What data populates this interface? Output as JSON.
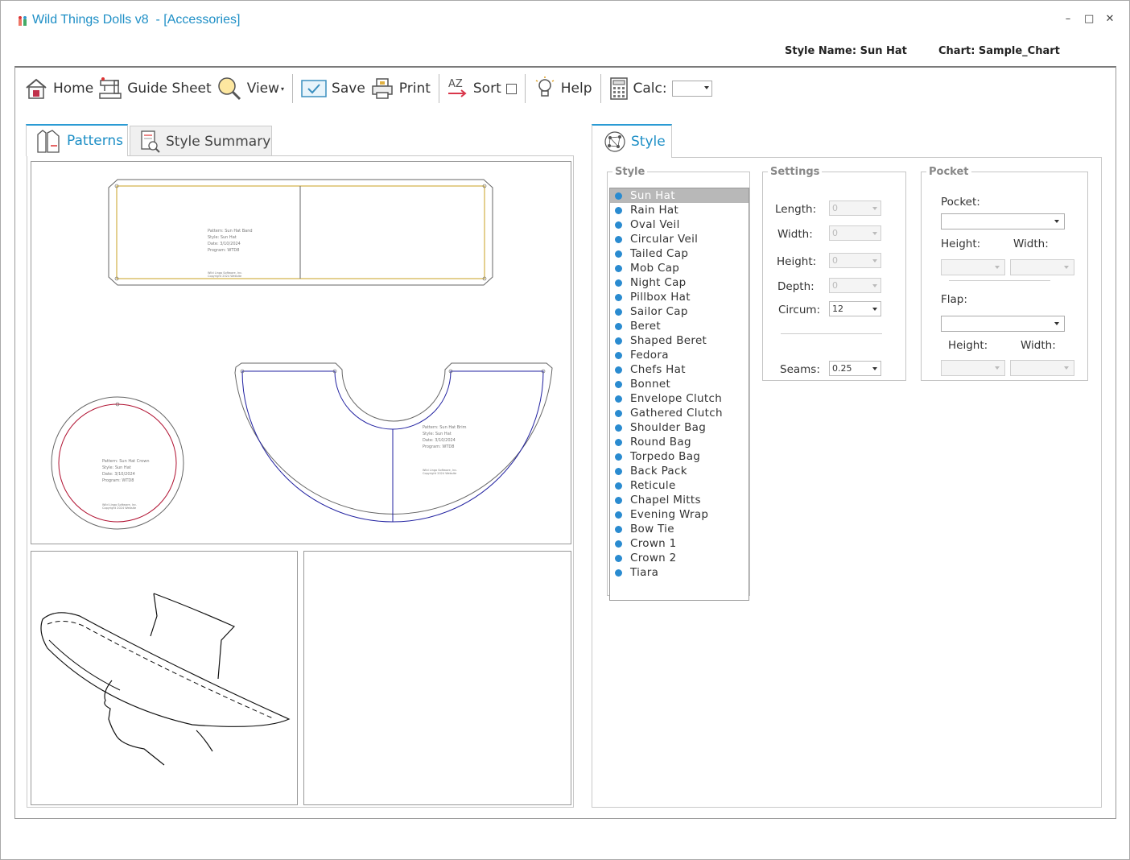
{
  "window": {
    "title": "Wild Things Dolls v8  - [Accessories]",
    "controls": {
      "minimize": "–",
      "maximize": "□",
      "close": "✕"
    }
  },
  "info": {
    "style_name": "Style Name: Sun Hat",
    "chart": "Chart: Sample_Chart"
  },
  "toolbar": {
    "home": "Home",
    "guide_sheet": "Guide Sheet",
    "view": "View",
    "save": "Save",
    "print": "Print",
    "sort_icon": "AZ",
    "sort": "Sort",
    "help": "Help",
    "calc": "Calc:"
  },
  "left_tabs": {
    "patterns": "Patterns",
    "style_summary": "Style Summary"
  },
  "patterns": {
    "band": [
      "Pattern: Sun Hat Band",
      "Style: Sun Hat",
      "Date: 3/10/2024",
      "Program: WTD8"
    ],
    "band_footer": [
      "Wild Lingo Software, Inc.",
      "Copyright 2024 Website"
    ],
    "crown": [
      "Pattern: Sun Hat Crown",
      "Style: Sun Hat",
      "Date: 3/10/2024",
      "Program: WTD8"
    ],
    "crown_footer": [
      "Wild Lingo Software, Inc.",
      "Copyright 2024 Website"
    ],
    "brim": [
      "Pattern: Sun Hat Brim",
      "Style: Sun Hat",
      "Date: 3/10/2024",
      "Program: WTD8"
    ],
    "brim_footer": [
      "Wild Lingo Software, Inc.",
      "Copyright 2024 Website"
    ]
  },
  "right_tab": {
    "style": "Style"
  },
  "style_group": {
    "legend": "Style",
    "selected_index": 0,
    "items": [
      "Sun Hat",
      "Rain Hat",
      "Oval Veil",
      "Circular Veil",
      "Tailed Cap",
      "Mob Cap",
      "Night Cap",
      "Pillbox Hat",
      "Sailor Cap",
      "Beret",
      "Shaped Beret",
      "Fedora",
      "Chefs Hat",
      "Bonnet",
      "Envelope Clutch",
      "Gathered Clutch",
      "Shoulder Bag",
      "Round Bag",
      "Torpedo Bag",
      "Back Pack",
      "Reticule",
      "Chapel Mitts",
      "Evening Wrap",
      "Bow Tie",
      "Crown 1",
      "Crown 2",
      "Tiara"
    ]
  },
  "settings": {
    "legend": "Settings",
    "length_label": "Length:",
    "length_value": "0",
    "width_label": "Width:",
    "width_value": "0",
    "height_label": "Height:",
    "height_value": "0",
    "depth_label": "Depth:",
    "depth_value": "0",
    "circum_label": "Circum:",
    "circum_value": "12",
    "seams_label": "Seams:",
    "seams_value": "0.25"
  },
  "pocket": {
    "legend": "Pocket",
    "pocket_label": "Pocket:",
    "height_label": "Height:",
    "width_label": "Width:",
    "flap_label": "Flap:",
    "flap_height_label": "Height:",
    "flap_width_label": "Width:"
  },
  "colors": {
    "accent": "#1e8fc6",
    "list_dot": "#2a8bd0",
    "band_line": "#c8a020",
    "crown_line": "#b01030",
    "brim_line": "#2020a0"
  }
}
